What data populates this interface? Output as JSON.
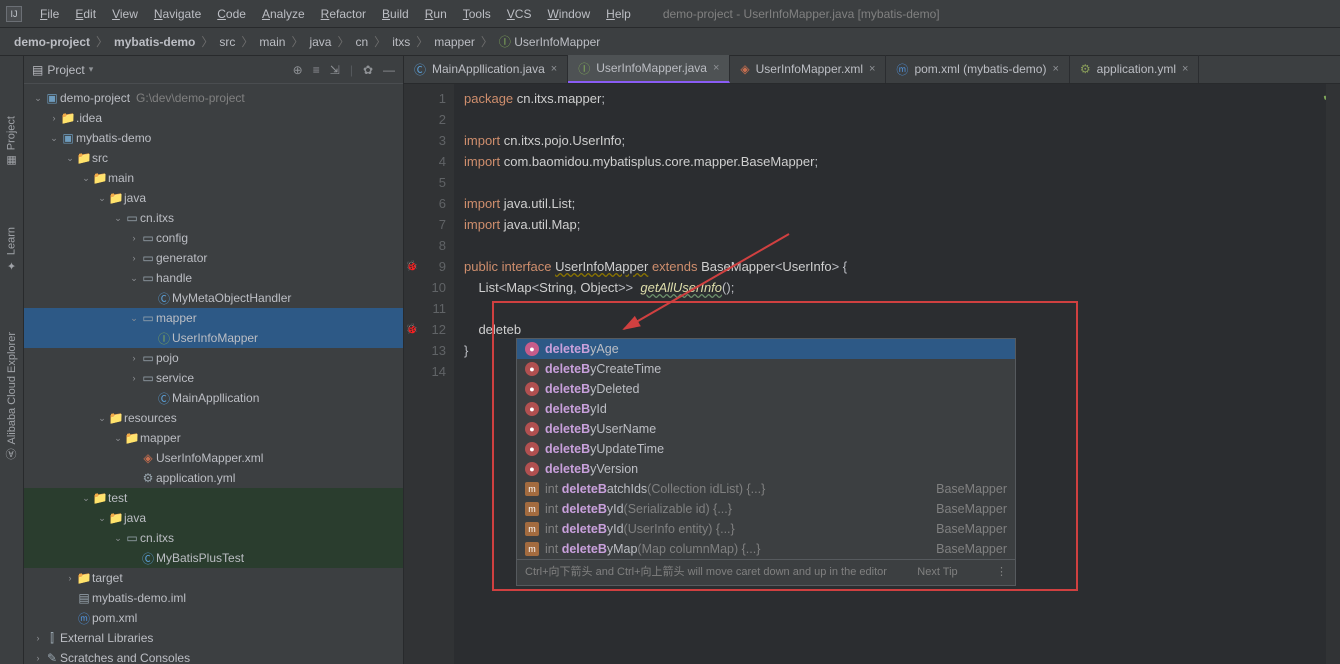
{
  "menu": {
    "items": [
      "File",
      "Edit",
      "View",
      "Navigate",
      "Code",
      "Analyze",
      "Refactor",
      "Build",
      "Run",
      "Tools",
      "VCS",
      "Window",
      "Help"
    ]
  },
  "title": "demo-project - UserInfoMapper.java [mybatis-demo]",
  "breadcrumbs": [
    "demo-project",
    "mybatis-demo",
    "src",
    "main",
    "java",
    "cn",
    "itxs",
    "mapper",
    "UserInfoMapper"
  ],
  "project_panel": {
    "title": "Project",
    "path_hint": "G:\\dev\\demo-project"
  },
  "tree": [
    {
      "d": 0,
      "a": "v",
      "t": "proj",
      "l": "demo-project",
      "hint": "G:\\dev\\demo-project"
    },
    {
      "d": 1,
      "a": ">",
      "t": "fol",
      "l": ".idea"
    },
    {
      "d": 1,
      "a": "v",
      "t": "mod",
      "l": "mybatis-demo"
    },
    {
      "d": 2,
      "a": "v",
      "t": "fol-b",
      "l": "src"
    },
    {
      "d": 3,
      "a": "v",
      "t": "fol-b",
      "l": "main"
    },
    {
      "d": 4,
      "a": "v",
      "t": "fol-b",
      "l": "java"
    },
    {
      "d": 5,
      "a": "v",
      "t": "pkg",
      "l": "cn.itxs"
    },
    {
      "d": 6,
      "a": ">",
      "t": "pkg",
      "l": "config"
    },
    {
      "d": 6,
      "a": ">",
      "t": "pkg",
      "l": "generator"
    },
    {
      "d": 6,
      "a": "v",
      "t": "pkg",
      "l": "handle"
    },
    {
      "d": 7,
      "a": "",
      "t": "cls",
      "l": "MyMetaObjectHandler"
    },
    {
      "d": 6,
      "a": "v",
      "t": "pkg",
      "l": "mapper",
      "sel": true
    },
    {
      "d": 7,
      "a": "",
      "t": "int",
      "l": "UserInfoMapper",
      "sel": true
    },
    {
      "d": 6,
      "a": ">",
      "t": "pkg",
      "l": "pojo"
    },
    {
      "d": 6,
      "a": ">",
      "t": "pkg",
      "l": "service"
    },
    {
      "d": 7,
      "a": "",
      "t": "cls",
      "l": "MainAppllication"
    },
    {
      "d": 4,
      "a": "v",
      "t": "fol",
      "l": "resources"
    },
    {
      "d": 5,
      "a": "v",
      "t": "fol",
      "l": "mapper"
    },
    {
      "d": 6,
      "a": "",
      "t": "xml",
      "l": "UserInfoMapper.xml"
    },
    {
      "d": 6,
      "a": "",
      "t": "yml",
      "l": "application.yml"
    },
    {
      "d": 3,
      "a": "v",
      "t": "fol-t",
      "l": "test",
      "grn": true
    },
    {
      "d": 4,
      "a": "v",
      "t": "fol-t",
      "l": "java",
      "grn": true
    },
    {
      "d": 5,
      "a": "v",
      "t": "pkg",
      "l": "cn.itxs",
      "grn": true
    },
    {
      "d": 6,
      "a": "",
      "t": "cls",
      "l": "MyBatisPlusTest",
      "grn": true
    },
    {
      "d": 2,
      "a": ">",
      "t": "fol-r",
      "l": "target"
    },
    {
      "d": 2,
      "a": "",
      "t": "file",
      "l": "mybatis-demo.iml"
    },
    {
      "d": 2,
      "a": "",
      "t": "mvn",
      "l": "pom.xml"
    },
    {
      "d": 0,
      "a": ">",
      "t": "lib",
      "l": "External Libraries"
    },
    {
      "d": 0,
      "a": ">",
      "t": "scr",
      "l": "Scratches and Consoles"
    }
  ],
  "tabs": [
    {
      "l": "MainAppllication.java",
      "ico": "cls",
      "active": false
    },
    {
      "l": "UserInfoMapper.java",
      "ico": "int",
      "active": true
    },
    {
      "l": "UserInfoMapper.xml",
      "ico": "xml",
      "active": false
    },
    {
      "l": "pom.xml (mybatis-demo)",
      "ico": "mvn",
      "active": false
    },
    {
      "l": "application.yml",
      "ico": "yml",
      "active": false
    }
  ],
  "code": {
    "l1": {
      "kw": "package",
      "pkg": "cn.itxs.mapper"
    },
    "l3": {
      "kw": "import",
      "pkg": "cn.itxs.pojo.UserInfo"
    },
    "l4": {
      "kw": "import",
      "pkg": "com.baomidou.mybatisplus.core.mapper.BaseMapper"
    },
    "l6": {
      "kw": "import",
      "pkg": "java.util.List"
    },
    "l7": {
      "kw": "import",
      "pkg": "java.util.Map"
    },
    "l9a": "public",
    "l9b": "interface",
    "l9c": "UserInfoMapper",
    "l9d": "extends",
    "l9e": "BaseMapper",
    "l9f": "UserInfo",
    "l10a": "List",
    "l10b": "Map",
    "l10c": "String",
    "l10d": "Object",
    "l10e": "getAllUserInfo",
    "l12": "deleteb",
    "l13": "}"
  },
  "lines": [
    "1",
    "2",
    "3",
    "4",
    "5",
    "6",
    "7",
    "8",
    "9",
    "10",
    "11",
    "12",
    "13",
    "14"
  ],
  "gutter_marks": {
    "9": "bug",
    "12": "bug"
  },
  "popup": {
    "items": [
      {
        "ico": "pink",
        "pre": "deleteB",
        "suf": "yAge",
        "sel": true
      },
      {
        "ico": "red",
        "pre": "deleteB",
        "suf": "yCreateTime"
      },
      {
        "ico": "red",
        "pre": "deleteB",
        "suf": "yDeleted"
      },
      {
        "ico": "red",
        "pre": "deleteB",
        "suf": "yId"
      },
      {
        "ico": "red",
        "pre": "deleteB",
        "suf": "yUserName"
      },
      {
        "ico": "red",
        "pre": "deleteB",
        "suf": "yUpdateTime"
      },
      {
        "ico": "red",
        "pre": "deleteB",
        "suf": "yVersion"
      },
      {
        "ico": "tag",
        "ret": "int",
        "pre": "deleteB",
        "suf": "atchIds",
        "args": "(Collection idList) {...}",
        "right": "BaseMapper"
      },
      {
        "ico": "tag",
        "ret": "int",
        "pre": "deleteB",
        "suf": "yId",
        "args": "(Serializable id) {...}",
        "right": "BaseMapper"
      },
      {
        "ico": "tag",
        "ret": "int",
        "pre": "deleteB",
        "suf": "yId",
        "args": "(UserInfo entity) {...}",
        "right": "BaseMapper"
      },
      {
        "ico": "tag",
        "ret": "int",
        "pre": "deleteB",
        "suf": "yMap",
        "args": "(Map columnMap) {...}",
        "right": "BaseMapper"
      }
    ],
    "footer_left": "Ctrl+向下箭头 and Ctrl+向上箭头 will move caret down and up in the editor",
    "footer_right": "Next Tip"
  },
  "side_tabs": {
    "project": "Project",
    "learn": "Learn",
    "cloud": "Alibaba Cloud Explorer"
  }
}
